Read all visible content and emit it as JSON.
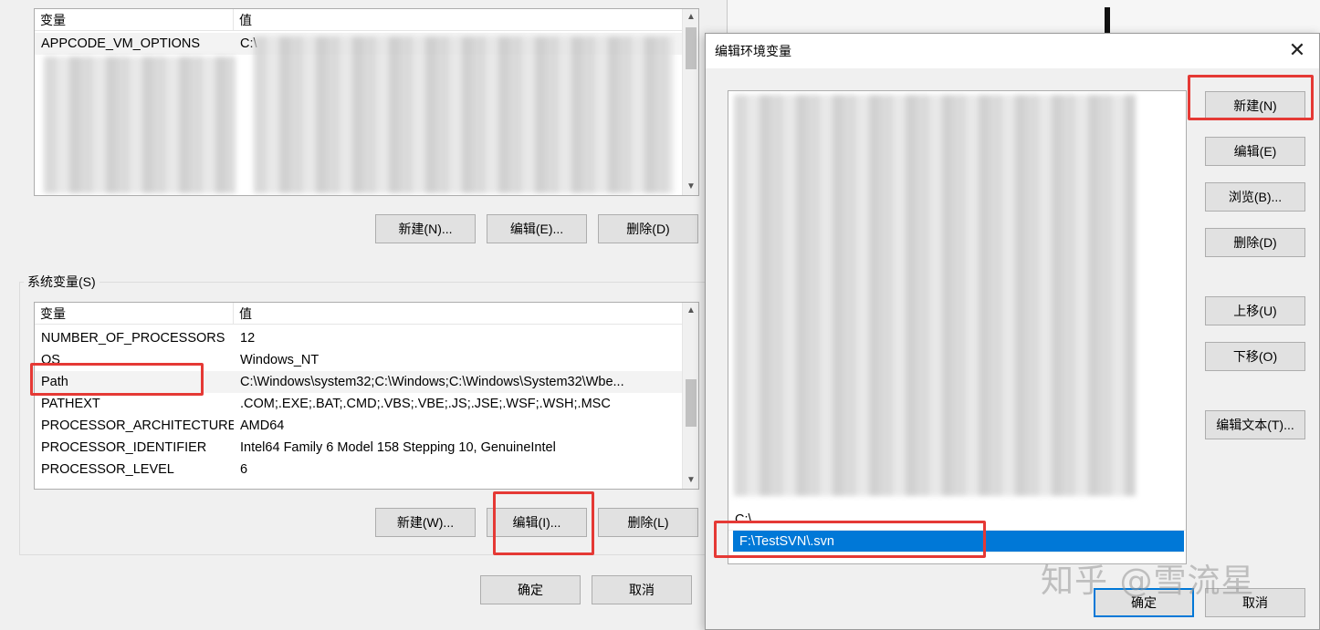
{
  "background_dialog": {
    "user_vars": {
      "header": {
        "name": "变量",
        "value": "值"
      },
      "rows": [
        {
          "name": "APPCODE_VM_OPTIONS",
          "value": "C:\\"
        }
      ],
      "buttons": {
        "new": "新建(N)...",
        "edit": "编辑(E)...",
        "delete": "删除(D)"
      }
    },
    "system_vars": {
      "group_label": "系统变量(S)",
      "header": {
        "name": "变量",
        "value": "值"
      },
      "rows": [
        {
          "name": "NUMBER_OF_PROCESSORS",
          "value": "12"
        },
        {
          "name": "OS",
          "value": "Windows_NT"
        },
        {
          "name": "Path",
          "value": "C:\\Windows\\system32;C:\\Windows;C:\\Windows\\System32\\Wbe..."
        },
        {
          "name": "PATHEXT",
          "value": ".COM;.EXE;.BAT;.CMD;.VBS;.VBE;.JS;.JSE;.WSF;.WSH;.MSC"
        },
        {
          "name": "PROCESSOR_ARCHITECTURE",
          "value": "AMD64"
        },
        {
          "name": "PROCESSOR_IDENTIFIER",
          "value": "Intel64 Family 6 Model 158 Stepping 10, GenuineIntel"
        },
        {
          "name": "PROCESSOR_LEVEL",
          "value": "6"
        }
      ],
      "buttons": {
        "new": "新建(W)...",
        "edit": "编辑(I)...",
        "delete": "删除(L)"
      }
    },
    "footer": {
      "ok": "确定",
      "cancel": "取消"
    }
  },
  "edit_dialog": {
    "title": "编辑环境变量",
    "close_icon": "✕",
    "path_entries": [
      {
        "text": "C:\\"
      },
      {
        "text": "F:\\TestSVN\\.svn",
        "selected": true
      }
    ],
    "buttons": {
      "new": "新建(N)",
      "edit": "编辑(E)",
      "browse": "浏览(B)...",
      "delete": "删除(D)",
      "move_up": "上移(U)",
      "move_down": "下移(O)",
      "edit_text": "编辑文本(T)...",
      "ok": "确定",
      "cancel": "取消"
    }
  },
  "watermark": "知乎 @雪流星",
  "colors": {
    "highlight": "#e53935",
    "selection": "#0078d7"
  }
}
